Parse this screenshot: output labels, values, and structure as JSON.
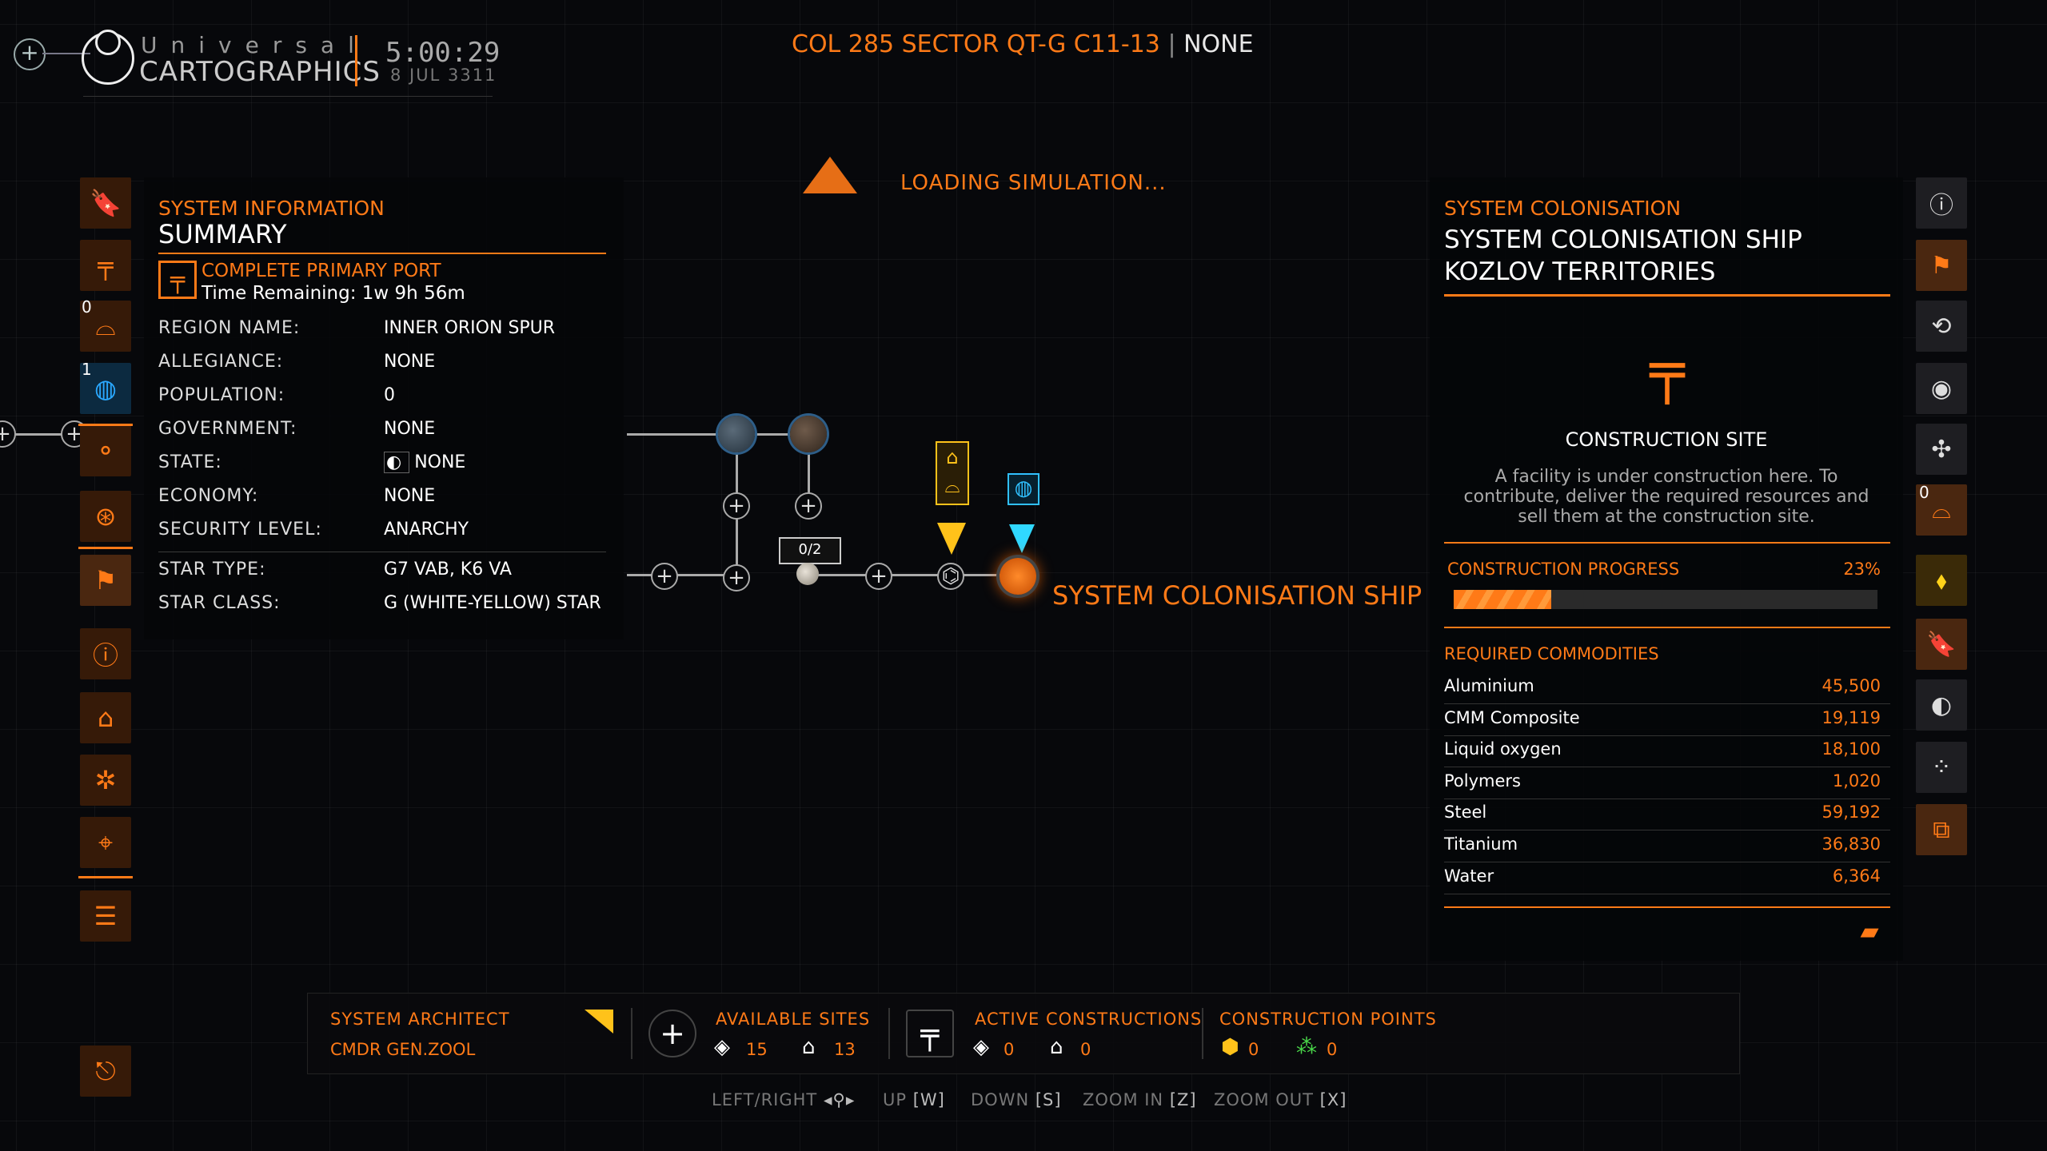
{
  "header": {
    "brand_top": "Universal",
    "brand_bottom": "CARTOGRAPHICS",
    "clock": "5:00:29",
    "date": "8 JUL 3311",
    "system_name": "COL 285 SECTOR QT-G C11-13",
    "system_faction": "NONE"
  },
  "left_bar": {
    "items": [
      {
        "icon": "bookmark-icon",
        "glyph": "🔖"
      },
      {
        "icon": "crane-icon",
        "glyph": "╤"
      },
      {
        "icon": "ring-icon",
        "glyph": "⌓",
        "badge": "0"
      },
      {
        "icon": "globe-icon",
        "glyph": "◍",
        "badge": "1"
      },
      {
        "icon": "route-icon",
        "glyph": "⚬"
      },
      {
        "icon": "target-icon",
        "glyph": "⊛"
      },
      {
        "icon": "flag-icon",
        "glyph": "⚑"
      },
      {
        "icon": "info-icon",
        "glyph": "ⓘ"
      },
      {
        "icon": "bank-icon",
        "glyph": "⌂"
      },
      {
        "icon": "settings-icon",
        "glyph": "✲"
      },
      {
        "icon": "pin-icon",
        "glyph": "⌖"
      },
      {
        "icon": "list-icon",
        "glyph": "☰"
      },
      {
        "icon": "exit-icon",
        "glyph": "⎋"
      }
    ]
  },
  "system_info": {
    "title": "SYSTEM INFORMATION",
    "subtitle": "SUMMARY",
    "port_title": "COMPLETE PRIMARY PORT",
    "port_time": "Time Remaining: 1w 9h 56m",
    "rows": [
      {
        "k": "REGION NAME:",
        "v": "INNER ORION SPUR"
      },
      {
        "k": "ALLEGIANCE:",
        "v": "NONE"
      },
      {
        "k": "POPULATION:",
        "v": "0"
      },
      {
        "k": "GOVERNMENT:",
        "v": "NONE"
      },
      {
        "k": "STATE:",
        "v": "NONE"
      },
      {
        "k": "ECONOMY:",
        "v": "NONE"
      },
      {
        "k": "SECURITY LEVEL:",
        "v": "ANARCHY"
      },
      {
        "k": "STAR TYPE:",
        "v": "G7 VAB, K6 VA"
      },
      {
        "k": "STAR CLASS:",
        "v": "G (WHITE-YELLOW) STAR"
      }
    ]
  },
  "map": {
    "loading": "LOADING SIMULATION...",
    "site_counter": "0/2",
    "station_label": "SYSTEM COLONISATION SHIP"
  },
  "colonisation": {
    "title": "SYSTEM COLONISATION",
    "ship_line1": "SYSTEM COLONISATION SHIP",
    "ship_line2": "KOZLOV TERRITORIES",
    "site_name": "CONSTRUCTION SITE",
    "site_desc": "A facility is under construction here. To contribute, deliver the required resources and sell them at the construction site.",
    "progress_label": "CONSTRUCTION PROGRESS",
    "progress_text": "23%",
    "progress": 0.23,
    "required_label": "REQUIRED COMMODITIES",
    "commodities": [
      {
        "name": "Aluminium",
        "qty": "45,500"
      },
      {
        "name": "CMM Composite",
        "qty": "19,119"
      },
      {
        "name": "Liquid oxygen",
        "qty": "18,100"
      },
      {
        "name": "Polymers",
        "qty": "1,020"
      },
      {
        "name": "Steel",
        "qty": "59,192"
      },
      {
        "name": "Titanium",
        "qty": "36,830"
      },
      {
        "name": "Water",
        "qty": "6,364"
      }
    ]
  },
  "right_bar": {
    "items": [
      {
        "icon": "system-info-icon",
        "glyph": "ⓘ"
      },
      {
        "icon": "colonisation-flag-icon",
        "glyph": "⚑"
      },
      {
        "icon": "scan-icon",
        "glyph": "⟲"
      },
      {
        "icon": "star-icon",
        "glyph": "◉"
      },
      {
        "icon": "satellite-icon",
        "glyph": "✣"
      },
      {
        "icon": "ring-icon",
        "glyph": "⌓",
        "badge": "0"
      },
      {
        "icon": "location-icon",
        "glyph": "⬧"
      },
      {
        "icon": "bookmark-icon",
        "glyph": "🔖"
      },
      {
        "icon": "moon-icon",
        "glyph": "◐"
      },
      {
        "icon": "network-icon",
        "glyph": "⁘"
      },
      {
        "icon": "transfer-icon",
        "glyph": "⧉"
      }
    ]
  },
  "bottom_bar": {
    "architect_label": "SYSTEM ARCHITECT",
    "architect_name": "CMDR GEN.ZOOL",
    "available_label": "AVAILABLE SITES",
    "available_orbital": "15",
    "available_surface": "13",
    "active_label": "ACTIVE CONSTRUCTIONS",
    "active_orbital": "0",
    "active_surface": "0",
    "points_label": "CONSTRUCTION POINTS",
    "points_a": "0",
    "points_b": "0"
  },
  "hints": [
    {
      "label": "LEFT/RIGHT",
      "key": "◂⚲▸"
    },
    {
      "label": "UP",
      "key": "[W]"
    },
    {
      "label": "DOWN",
      "key": "[S]"
    },
    {
      "label": "ZOOM IN",
      "key": "[Z]"
    },
    {
      "label": "ZOOM OUT",
      "key": "[X]"
    }
  ]
}
